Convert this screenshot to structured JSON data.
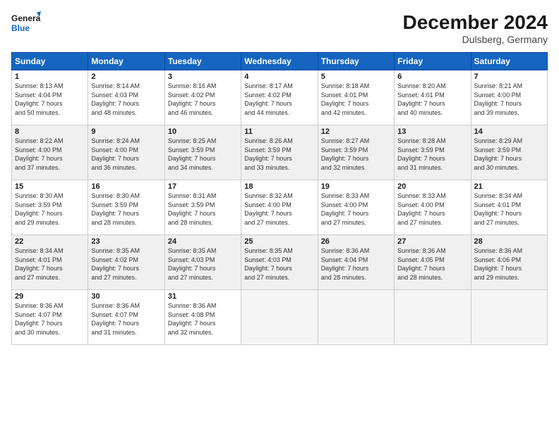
{
  "header": {
    "logo_line1": "General",
    "logo_line2": "Blue",
    "month_title": "December 2024",
    "subtitle": "Dulsberg, Germany"
  },
  "columns": [
    "Sunday",
    "Monday",
    "Tuesday",
    "Wednesday",
    "Thursday",
    "Friday",
    "Saturday"
  ],
  "weeks": [
    [
      {
        "day": "1",
        "detail": "Sunrise: 8:13 AM\nSunset: 4:04 PM\nDaylight: 7 hours\nand 50 minutes.",
        "shade": false
      },
      {
        "day": "2",
        "detail": "Sunrise: 8:14 AM\nSunset: 4:03 PM\nDaylight: 7 hours\nand 48 minutes.",
        "shade": false
      },
      {
        "day": "3",
        "detail": "Sunrise: 8:16 AM\nSunset: 4:02 PM\nDaylight: 7 hours\nand 46 minutes.",
        "shade": false
      },
      {
        "day": "4",
        "detail": "Sunrise: 8:17 AM\nSunset: 4:02 PM\nDaylight: 7 hours\nand 44 minutes.",
        "shade": false
      },
      {
        "day": "5",
        "detail": "Sunrise: 8:18 AM\nSunset: 4:01 PM\nDaylight: 7 hours\nand 42 minutes.",
        "shade": false
      },
      {
        "day": "6",
        "detail": "Sunrise: 8:20 AM\nSunset: 4:01 PM\nDaylight: 7 hours\nand 40 minutes.",
        "shade": false
      },
      {
        "day": "7",
        "detail": "Sunrise: 8:21 AM\nSunset: 4:00 PM\nDaylight: 7 hours\nand 39 minutes.",
        "shade": false
      }
    ],
    [
      {
        "day": "8",
        "detail": "Sunrise: 8:22 AM\nSunset: 4:00 PM\nDaylight: 7 hours\nand 37 minutes.",
        "shade": true
      },
      {
        "day": "9",
        "detail": "Sunrise: 8:24 AM\nSunset: 4:00 PM\nDaylight: 7 hours\nand 36 minutes.",
        "shade": true
      },
      {
        "day": "10",
        "detail": "Sunrise: 8:25 AM\nSunset: 3:59 PM\nDaylight: 7 hours\nand 34 minutes.",
        "shade": true
      },
      {
        "day": "11",
        "detail": "Sunrise: 8:26 AM\nSunset: 3:59 PM\nDaylight: 7 hours\nand 33 minutes.",
        "shade": true
      },
      {
        "day": "12",
        "detail": "Sunrise: 8:27 AM\nSunset: 3:59 PM\nDaylight: 7 hours\nand 32 minutes.",
        "shade": true
      },
      {
        "day": "13",
        "detail": "Sunrise: 8:28 AM\nSunset: 3:59 PM\nDaylight: 7 hours\nand 31 minutes.",
        "shade": true
      },
      {
        "day": "14",
        "detail": "Sunrise: 8:29 AM\nSunset: 3:59 PM\nDaylight: 7 hours\nand 30 minutes.",
        "shade": true
      }
    ],
    [
      {
        "day": "15",
        "detail": "Sunrise: 8:30 AM\nSunset: 3:59 PM\nDaylight: 7 hours\nand 29 minutes.",
        "shade": false
      },
      {
        "day": "16",
        "detail": "Sunrise: 8:30 AM\nSunset: 3:59 PM\nDaylight: 7 hours\nand 28 minutes.",
        "shade": false
      },
      {
        "day": "17",
        "detail": "Sunrise: 8:31 AM\nSunset: 3:59 PM\nDaylight: 7 hours\nand 28 minutes.",
        "shade": false
      },
      {
        "day": "18",
        "detail": "Sunrise: 8:32 AM\nSunset: 4:00 PM\nDaylight: 7 hours\nand 27 minutes.",
        "shade": false
      },
      {
        "day": "19",
        "detail": "Sunrise: 8:33 AM\nSunset: 4:00 PM\nDaylight: 7 hours\nand 27 minutes.",
        "shade": false
      },
      {
        "day": "20",
        "detail": "Sunrise: 8:33 AM\nSunset: 4:00 PM\nDaylight: 7 hours\nand 27 minutes.",
        "shade": false
      },
      {
        "day": "21",
        "detail": "Sunrise: 8:34 AM\nSunset: 4:01 PM\nDaylight: 7 hours\nand 27 minutes.",
        "shade": false
      }
    ],
    [
      {
        "day": "22",
        "detail": "Sunrise: 8:34 AM\nSunset: 4:01 PM\nDaylight: 7 hours\nand 27 minutes.",
        "shade": true
      },
      {
        "day": "23",
        "detail": "Sunrise: 8:35 AM\nSunset: 4:02 PM\nDaylight: 7 hours\nand 27 minutes.",
        "shade": true
      },
      {
        "day": "24",
        "detail": "Sunrise: 8:35 AM\nSunset: 4:03 PM\nDaylight: 7 hours\nand 27 minutes.",
        "shade": true
      },
      {
        "day": "25",
        "detail": "Sunrise: 8:35 AM\nSunset: 4:03 PM\nDaylight: 7 hours\nand 27 minutes.",
        "shade": true
      },
      {
        "day": "26",
        "detail": "Sunrise: 8:36 AM\nSunset: 4:04 PM\nDaylight: 7 hours\nand 28 minutes.",
        "shade": true
      },
      {
        "day": "27",
        "detail": "Sunrise: 8:36 AM\nSunset: 4:05 PM\nDaylight: 7 hours\nand 28 minutes.",
        "shade": true
      },
      {
        "day": "28",
        "detail": "Sunrise: 8:36 AM\nSunset: 4:06 PM\nDaylight: 7 hours\nand 29 minutes.",
        "shade": true
      }
    ],
    [
      {
        "day": "29",
        "detail": "Sunrise: 8:36 AM\nSunset: 4:07 PM\nDaylight: 7 hours\nand 30 minutes.",
        "shade": false
      },
      {
        "day": "30",
        "detail": "Sunrise: 8:36 AM\nSunset: 4:07 PM\nDaylight: 7 hours\nand 31 minutes.",
        "shade": false
      },
      {
        "day": "31",
        "detail": "Sunrise: 8:36 AM\nSunset: 4:08 PM\nDaylight: 7 hours\nand 32 minutes.",
        "shade": false
      },
      {
        "day": "",
        "detail": "",
        "shade": false,
        "empty": true
      },
      {
        "day": "",
        "detail": "",
        "shade": false,
        "empty": true
      },
      {
        "day": "",
        "detail": "",
        "shade": false,
        "empty": true
      },
      {
        "day": "",
        "detail": "",
        "shade": false,
        "empty": true
      }
    ]
  ]
}
